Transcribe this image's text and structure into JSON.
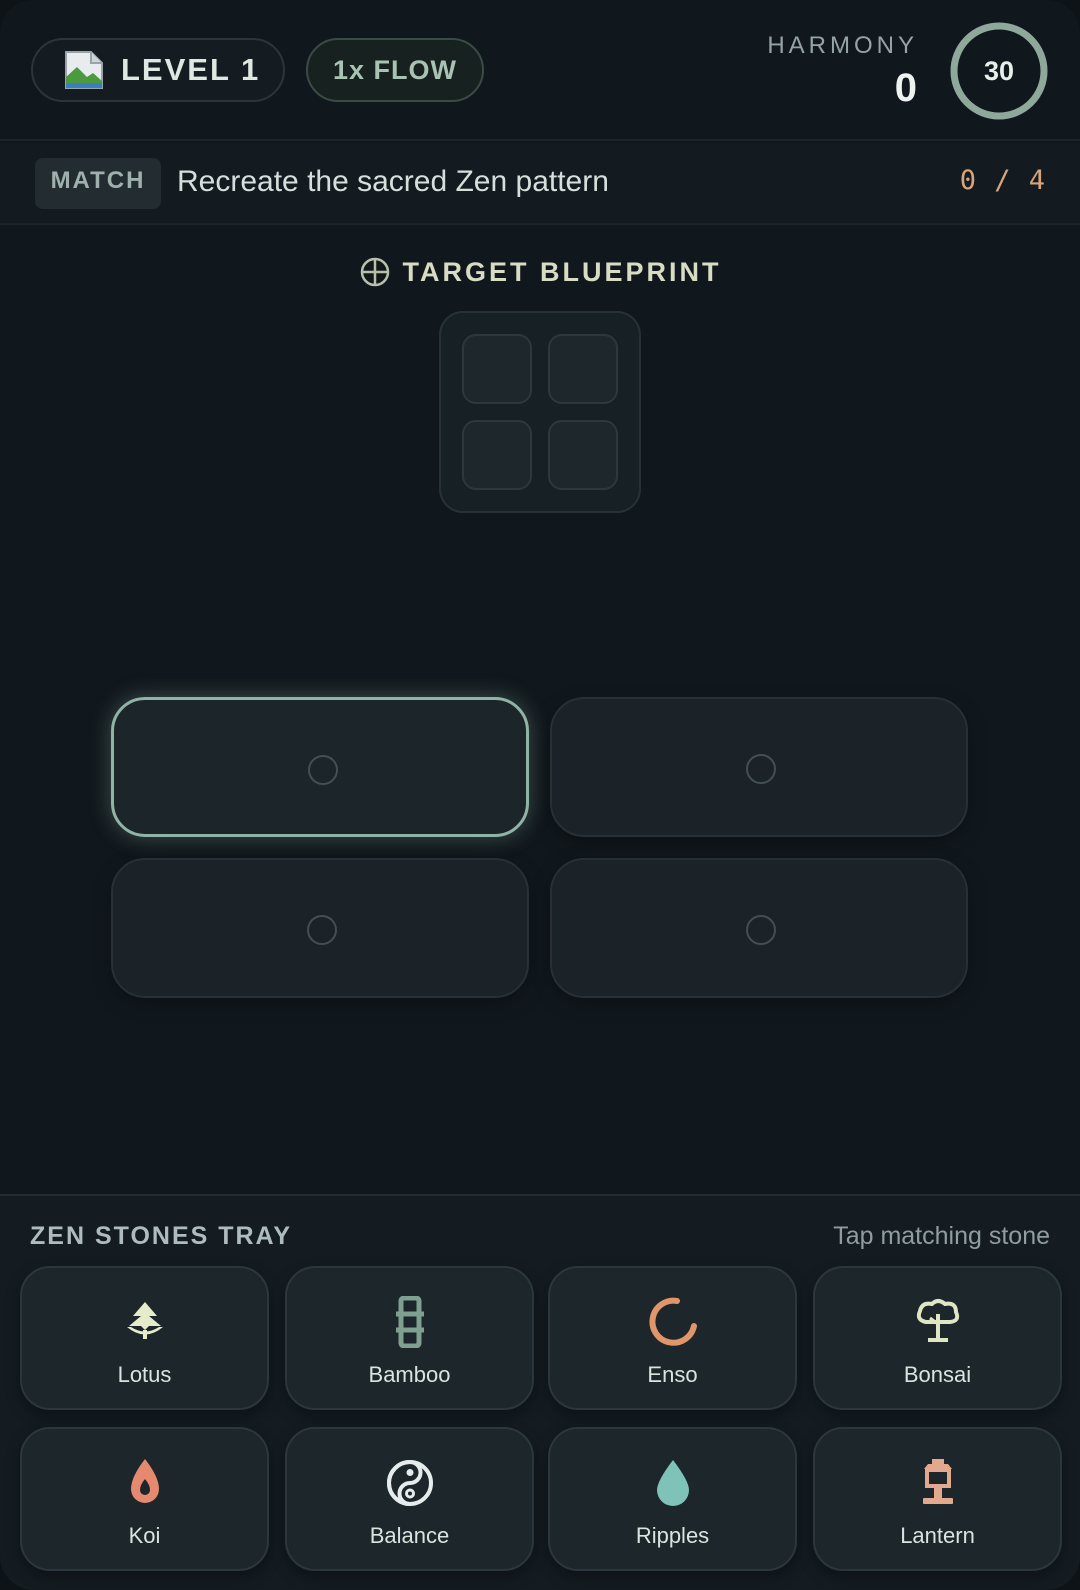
{
  "header": {
    "level_label": "LEVEL 1",
    "flow_label": "1x FLOW",
    "harmony_label": "HARMONY",
    "harmony_value": "0",
    "timer_value": "30",
    "timer_fraction": 1.0
  },
  "objective": {
    "badge": "MATCH",
    "text": "Recreate the sacred Zen pattern",
    "progress": "0 / 4"
  },
  "blueprint": {
    "title": "TARGET BLUEPRINT",
    "icon": "crosshair-icon"
  },
  "board": {
    "slots": [
      {
        "state": "active"
      },
      {
        "state": "empty"
      },
      {
        "state": "empty"
      },
      {
        "state": "empty"
      }
    ]
  },
  "tray": {
    "title": "ZEN STONES TRAY",
    "hint": "Tap matching stone",
    "stones": [
      {
        "label": "Lotus",
        "icon": "lotus-icon",
        "color": "#e6ecc9"
      },
      {
        "label": "Bamboo",
        "icon": "bamboo-icon",
        "color": "#7fa090"
      },
      {
        "label": "Enso",
        "icon": "enso-icon",
        "color": "#e0956a"
      },
      {
        "label": "Bonsai",
        "icon": "bonsai-icon",
        "color": "#dfe6c3"
      },
      {
        "label": "Koi",
        "icon": "koi-icon",
        "color": "#e58a6e"
      },
      {
        "label": "Balance",
        "icon": "yin-yang-icon",
        "color": "#e6ecec"
      },
      {
        "label": "Ripples",
        "icon": "water-drop-icon",
        "color": "#7fc3b8"
      },
      {
        "label": "Lantern",
        "icon": "lantern-icon",
        "color": "#e2a98f"
      }
    ]
  },
  "colors": {
    "accent": "#8fb3a4",
    "progress": "#d9a47a",
    "background": "#11181d"
  }
}
